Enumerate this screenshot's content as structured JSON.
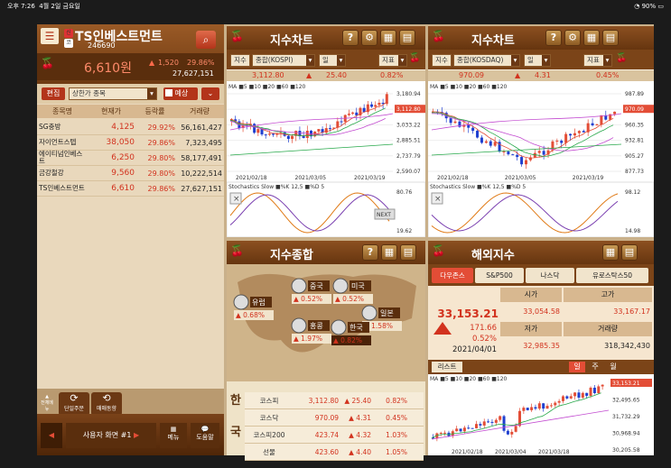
{
  "status": {
    "time": "오후 7:26",
    "date": "4월 2일 금요일",
    "battery": "90%"
  },
  "stock": {
    "badge1": "신",
    "badge2": "코",
    "name": "TS인베스트먼트",
    "code": "246690",
    "price": "6,610원",
    "change": "1,520",
    "rate": "29.86%",
    "volume": "27,627,151"
  },
  "list": {
    "edit": "편집",
    "filter": "상한가 종목",
    "forecast": "예상",
    "headers": [
      "종목명",
      "현재가",
      "등락률",
      "거래량"
    ],
    "rows": [
      {
        "name": "SG충방",
        "price": "4,125",
        "rate": "29.92%",
        "vol": "56,161,427"
      },
      {
        "name": "자이언트스텝",
        "price": "38,050",
        "rate": "29.86%",
        "vol": "7,323,495"
      },
      {
        "name": "에이티넘인베스트",
        "price": "6,250",
        "rate": "29.80%",
        "vol": "58,177,491"
      },
      {
        "name": "금강철강",
        "price": "9,560",
        "rate": "29.80%",
        "vol": "10,222,514"
      },
      {
        "name": "TS인베스트먼트",
        "price": "6,610",
        "rate": "29.86%",
        "vol": "27,627,151"
      }
    ]
  },
  "bottom": {
    "all_menu": "전체메뉴",
    "single_order": "단일주문",
    "sell_wait": "매매동향",
    "user_screen": "사용자 화면 #1",
    "menu": "메뉴",
    "help": "도움말"
  },
  "kospi": {
    "title": "지수차트",
    "tab": "지수",
    "market": "종합(KOSPI)",
    "period": "일",
    "indicator": "지표",
    "value": "3,112.80",
    "change": "25.40",
    "rate": "0.82%",
    "legend": "MA ■5 ■10 ■20 ■60 ■120",
    "stoch": "Stochastics Slow ■%K 12,5 ■%D 5",
    "next": "NEXT",
    "yticks": [
      "3,180.94",
      "3,112.80",
      "3,033.22",
      "2,885.51",
      "2,737.79",
      "2,590.07"
    ],
    "xticks": [
      "2021/02/18",
      "2021/03/05",
      "2021/03/19"
    ],
    "s_high": "80.76",
    "s_low": "19.62"
  },
  "kosdaq": {
    "title": "지수차트",
    "tab": "지수",
    "market": "종합(KOSDAQ)",
    "period": "일",
    "indicator": "지표",
    "value": "970.09",
    "change": "4.31",
    "rate": "0.45%",
    "legend": "MA ■5 ■10 ■20 ■60 ■120",
    "stoch": "Stochastics Slow ■%K 12,5 ■%D 5",
    "yticks": [
      "987.89",
      "970.09",
      "960.35",
      "932.81",
      "905.27",
      "877.73"
    ],
    "xticks": [
      "2021/02/18",
      "2021/03/05",
      "2021/03/19"
    ],
    "s_high": "98.12",
    "s_low": "14.98"
  },
  "summary": {
    "title": "지수종합",
    "regions": [
      {
        "name": "유럽",
        "rate": "0.68%",
        "dir": "▲"
      },
      {
        "name": "중국",
        "rate": "0.52%",
        "dir": "▲"
      },
      {
        "name": "미국",
        "rate": "0.52%",
        "dir": "▲"
      },
      {
        "name": "일본",
        "rate": "1.58%",
        "dir": "▲"
      },
      {
        "name": "홍콩",
        "rate": "1.97%",
        "dir": "▲"
      },
      {
        "name": "한국",
        "rate": "0.82%",
        "dir": "▲"
      }
    ],
    "side": [
      "한",
      "국"
    ],
    "rows": [
      {
        "name": "코스피",
        "value": "3,112.80",
        "chg": "25.40",
        "rate": "0.82%"
      },
      {
        "name": "코스닥",
        "value": "970.09",
        "chg": "4.31",
        "rate": "0.45%"
      },
      {
        "name": "코스피200",
        "value": "423.74",
        "chg": "4.32",
        "rate": "1.03%"
      },
      {
        "name": "선물",
        "value": "423.60",
        "chg": "4.40",
        "rate": "1.05%"
      }
    ]
  },
  "overseas": {
    "title": "해외지수",
    "tabs": [
      "다우존스",
      "S&P500",
      "나스닥",
      "유로스탁스50"
    ],
    "value": "33,153.21",
    "change": "171.66",
    "rate": "0.52%",
    "date": "2021/04/01",
    "open_label": "시가",
    "open": "33,054.58",
    "high_label": "고가",
    "high": "33,167.17",
    "low_label": "저가",
    "low": "32,985.35",
    "vol_label": "거래량",
    "vol": "318,342,430",
    "list_label": "리스트",
    "periods": [
      "일",
      "주",
      "월"
    ],
    "legend": "MA ■5 ■10 ■20 ■60 ■120",
    "yticks": [
      "33,153.21",
      "32,495.65",
      "31,732.29",
      "30,968.94",
      "30,205.58"
    ],
    "xticks": [
      "2021/02/18",
      "2021/03/04",
      "2021/03/18"
    ]
  }
}
